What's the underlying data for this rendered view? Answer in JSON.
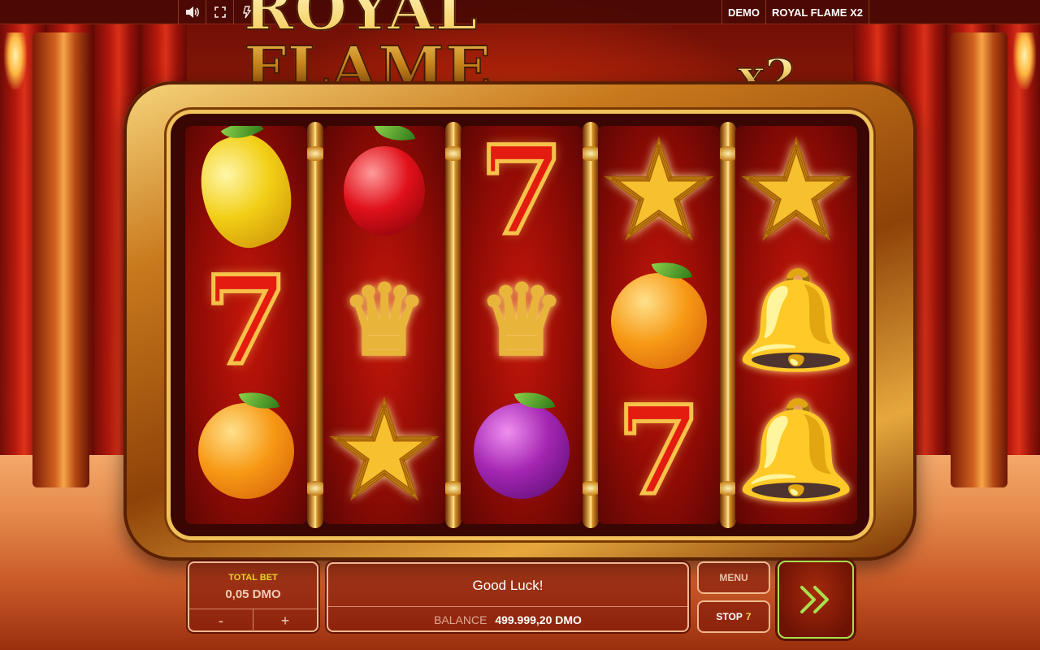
{
  "topbar": {
    "icons": [
      "speaker-icon",
      "fullscreen-icon",
      "turbo-icon"
    ],
    "mode": "DEMO",
    "game_title": "ROYAL FLAME X2"
  },
  "logo": {
    "text": "ROYAL FLAME",
    "suffix": "x2"
  },
  "reels": [
    [
      "lemon",
      "seven",
      "orange"
    ],
    [
      "cherry",
      "crown",
      "star"
    ],
    [
      "seven",
      "crown",
      "plum"
    ],
    [
      "star",
      "orange",
      "seven"
    ],
    [
      "star",
      "bell",
      "bell"
    ]
  ],
  "bet": {
    "title": "TOTAL BET",
    "value": "0,05 DMO",
    "minus": "-",
    "plus": "+"
  },
  "message": {
    "text": "Good Luck!",
    "balance_label": "BALANCE",
    "balance_value": "499.999,20 DMO"
  },
  "controls": {
    "menu": "MENU",
    "stop_label": "STOP",
    "stop_count": "7",
    "spin_icon": "double-chevron-right-icon"
  },
  "colors": {
    "accent_gold": "#f2c35a",
    "spin_green": "#a8e04f",
    "bet_title": "#e8d22a"
  }
}
